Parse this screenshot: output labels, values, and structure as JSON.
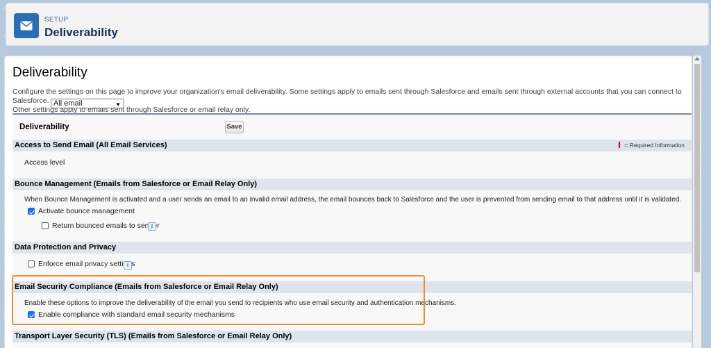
{
  "header": {
    "eyebrow": "SETUP",
    "title": "Deliverability",
    "icon": "envelope-icon"
  },
  "page": {
    "title": "Deliverability",
    "intro_line1": "Configure the settings on this page to improve your organization's email deliverability. Some settings apply to emails sent through Salesforce and emails sent through external accounts that you can connect to Salesforce.",
    "intro_line2": "Other settings apply to emails sent through Salesforce or email relay only."
  },
  "block": {
    "title": "Deliverability",
    "save_label": "Save",
    "required_info": "= Required Information"
  },
  "sections": {
    "access": {
      "title": "Access to Send Email (All Email Services)",
      "access_label": "Access level",
      "access_value": "All email"
    },
    "bounce": {
      "title": "Bounce Management (Emails from Salesforce or Email Relay Only)",
      "description": "When Bounce Management is activated and a user sends an email to an invalid email address, the email bounces back to Salesforce and the user is prevented from sending email to that address until it is validated.",
      "activate_label": "Activate bounce management",
      "activate_checked": true,
      "return_label": "Return bounced emails to sender",
      "return_checked": false
    },
    "privacy": {
      "title": "Data Protection and Privacy",
      "enforce_label": "Enforce email privacy settings",
      "enforce_checked": false
    },
    "security": {
      "title": "Email Security Compliance (Emails from Salesforce or Email Relay Only)",
      "description": "Enable these options to improve the deliverability of the email you send to recipients who use email security and authentication mechanisms.",
      "compliance_label": "Enable compliance with standard email security mechanisms",
      "compliance_checked": true
    },
    "tls": {
      "title": "Transport Layer Security (TLS) (Emails from Salesforce or Email Relay Only)"
    }
  },
  "colors": {
    "highlight": "#f08a2c",
    "header_icon_bg": "#2a6fb6",
    "section_bar": "#dfe4ec"
  }
}
